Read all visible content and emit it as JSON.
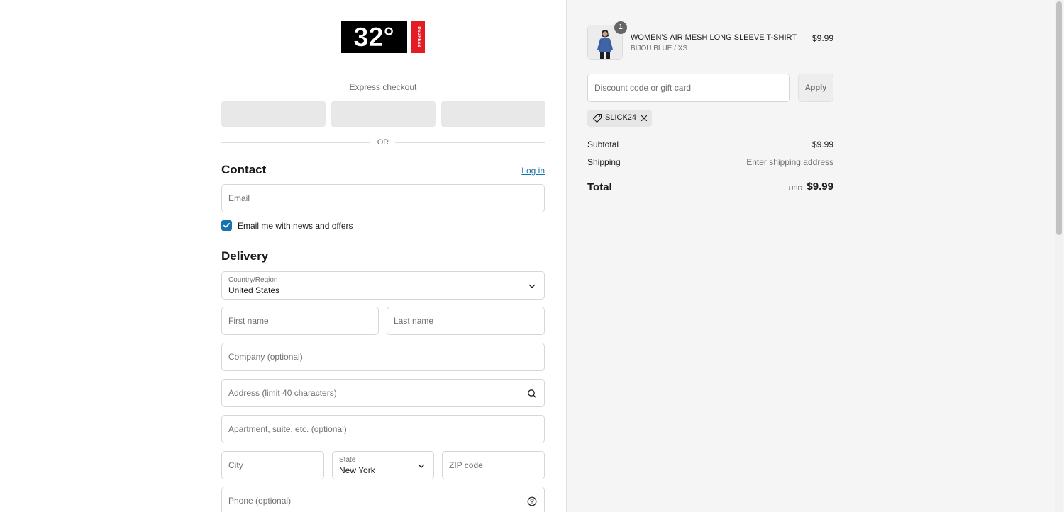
{
  "colors": {
    "accent": "#1773b0",
    "right_bg": "#f5f5f5",
    "express_btn": "#e8e8e8"
  },
  "brand": {
    "logo_text": "32°",
    "logo_side_text": "DEGREES"
  },
  "express": {
    "title": "Express checkout",
    "or_label": "OR"
  },
  "contact": {
    "heading": "Contact",
    "login_label": "Log in",
    "email_placeholder": "Email",
    "newsletter_label": "Email me with news and offers",
    "newsletter_checked": true
  },
  "delivery": {
    "heading": "Delivery",
    "country_label": "Country/Region",
    "country_value": "United States",
    "first_name_placeholder": "First name",
    "last_name_placeholder": "Last name",
    "company_placeholder": "Company (optional)",
    "address_placeholder": "Address (limit 40 characters)",
    "apartment_placeholder": "Apartment, suite, etc. (optional)",
    "city_placeholder": "City",
    "state_label": "State",
    "state_value": "New York",
    "zip_placeholder": "ZIP code",
    "phone_placeholder": "Phone (optional)"
  },
  "order": {
    "item": {
      "quantity": "1",
      "title": "WOMEN'S AIR MESH LONG SLEEVE T-SHIRT",
      "variant": "BIJOU BLUE / XS",
      "price": "$9.99"
    },
    "discount_placeholder": "Discount code or gift card",
    "apply_label": "Apply",
    "applied_code": "SLICK24",
    "subtotal_label": "Subtotal",
    "subtotal_value": "$9.99",
    "shipping_label": "Shipping",
    "shipping_value": "Enter shipping address",
    "total_label": "Total",
    "total_currency": "USD",
    "total_value": "$9.99"
  }
}
